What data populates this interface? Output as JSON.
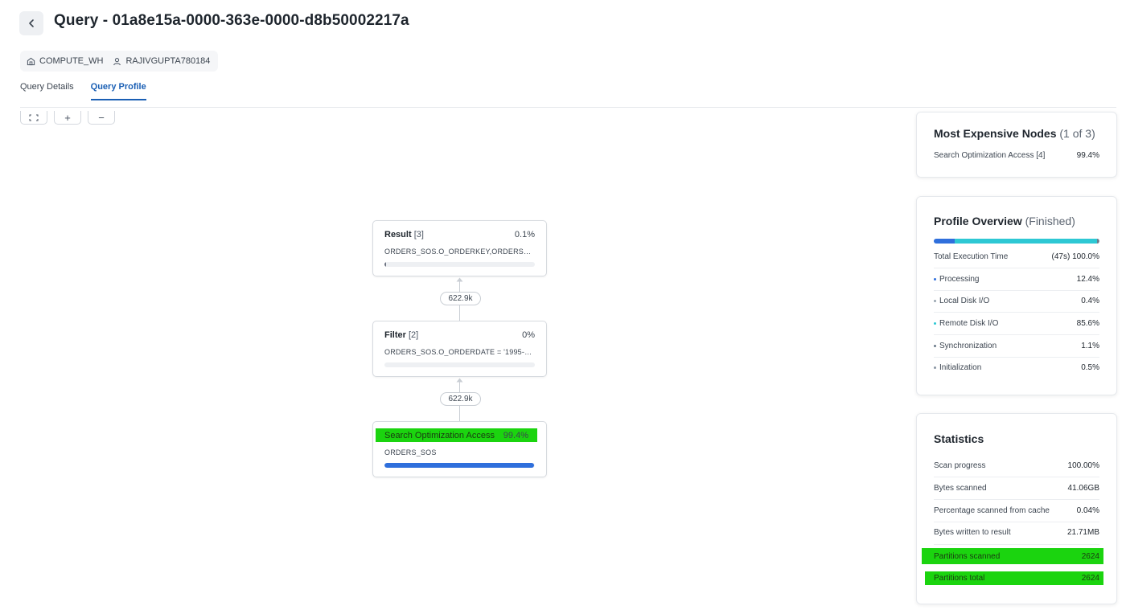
{
  "header": {
    "title": "Query - 01a8e15a-0000-363e-0000-d8b50002217a",
    "warehouse": "COMPUTE_WH",
    "user": "RAJIVGUPTA780184"
  },
  "tabs": [
    {
      "label": "Query Details",
      "active": false
    },
    {
      "label": "Query Profile",
      "active": true
    }
  ],
  "zoom": {
    "fit": "⛶",
    "zoom_in": "+",
    "zoom_out": "−"
  },
  "nodes": [
    {
      "name": "Result",
      "index": "[3]",
      "pct": "0.1%",
      "detail": "ORDERS_SOS.O_ORDERKEY,ORDERS_S...",
      "fill": 0.001
    },
    {
      "name": "Filter",
      "index": "[2]",
      "pct": "0%",
      "detail": "ORDERS_SOS.O_ORDERDATE = '1995-0...",
      "fill": 0
    },
    {
      "name": "Search Optimization Access",
      "index": "",
      "pct": "99.4%",
      "detail": "ORDERS_SOS",
      "fill": 0.994
    }
  ],
  "edges": [
    {
      "rows": "622.9k"
    },
    {
      "rows": "622.9k"
    }
  ],
  "most_expensive": {
    "title": "Most Expensive Nodes",
    "count": "(1 of 3)",
    "items": [
      {
        "label": "Search Optimization Access [4]",
        "value": "99.4%"
      }
    ]
  },
  "profile_overview": {
    "title": "Profile Overview",
    "status": "(Finished)",
    "total_label": "Total Execution Time",
    "total_time": "(47s)",
    "total_pct": "100.0%",
    "items": [
      {
        "label": "Processing",
        "value": "12.4%",
        "fraction": 0.124,
        "color": "#2f6fdc"
      },
      {
        "label": "Local Disk I/O",
        "value": "0.4%",
        "fraction": 0.004,
        "color": "#9aa5b1"
      },
      {
        "label": "Remote Disk I/O",
        "value": "85.6%",
        "fraction": 0.856,
        "color": "#2ec8d4"
      },
      {
        "label": "Synchronization",
        "value": "1.1%",
        "fraction": 0.011,
        "color": "#6b7a8a"
      },
      {
        "label": "Initialization",
        "value": "0.5%",
        "fraction": 0.005,
        "color": "#8a96a3"
      }
    ]
  },
  "statistics": {
    "title": "Statistics",
    "items": [
      {
        "label": "Scan progress",
        "value": "100.00%"
      },
      {
        "label": "Bytes scanned",
        "value": "41.06GB"
      },
      {
        "label": "Percentage scanned from cache",
        "value": "0.04%"
      },
      {
        "label": "Bytes written to result",
        "value": "21.71MB"
      },
      {
        "label": "Partitions scanned",
        "value": "2624"
      },
      {
        "label": "Partitions total",
        "value": "2624"
      }
    ]
  }
}
